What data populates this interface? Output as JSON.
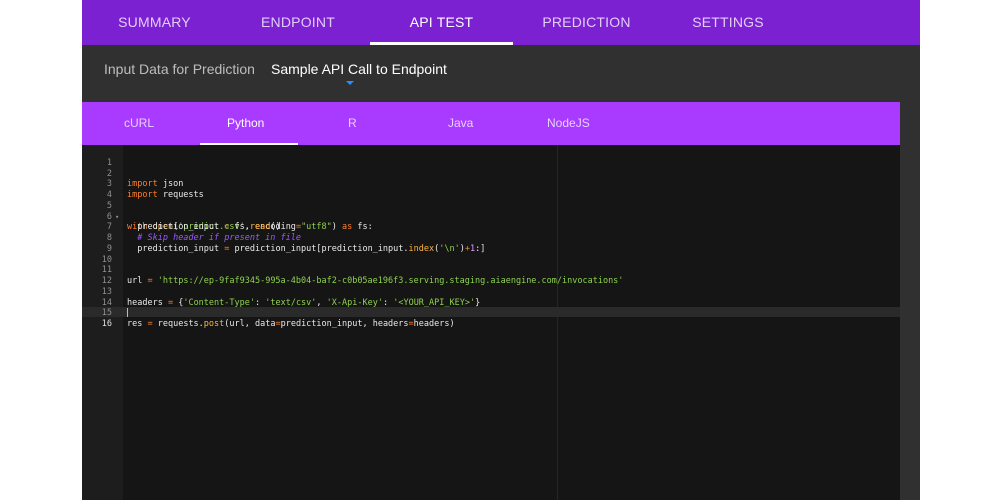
{
  "top_tabs": [
    "SUMMARY",
    "ENDPOINT",
    "API TEST",
    "PREDICTION",
    "SETTINGS"
  ],
  "sub_tabs": [
    "Input Data for Prediction",
    "Sample API Call to Endpoint"
  ],
  "language_tabs": [
    "cURL",
    "Python",
    "R",
    "Java",
    "NodeJS"
  ],
  "active_top_tab": "API TEST",
  "active_sub_tab": "Sample API Call to Endpoint",
  "active_language": "Python",
  "colors": {
    "top_bar": "#7b21d2",
    "language_bar": "#a93aff",
    "editor_bg": "#151515"
  },
  "code_line_numbers": [
    "1",
    "2",
    "3",
    "4",
    "5",
    "6",
    "7",
    "8",
    "9",
    "10",
    "11",
    "12",
    "13",
    "14",
    "15",
    "16"
  ],
  "code_tokens": {
    "import": "import",
    "json": " json",
    "requests": " requests",
    "with": "with",
    "open": "open",
    "open_paren": "(",
    "predict_csv": "'predict.csv'",
    "encoding_kw": ", encoding",
    "eq": "=",
    "utf8": "\"utf8\"",
    "close_paren": ")",
    "as": "as",
    "fs_colon": " fs:",
    "indent": "  ",
    "prediction_input": "prediction_input",
    "fs_read": "fs.",
    "read": "read",
    "parens": "()",
    "comment": "# Skip header if present in file",
    "slice_start": "prediction_input[prediction_input.",
    "index": "index",
    "newline_str": "'\\n'",
    "plus": "+",
    "one": "1",
    "slice_end": ":]",
    "url": "url",
    "url_value": "'https://ep-9faf9345-995a-4b04-baf2-c0b05ae196f3.serving.staging.aiaengine.com/invocations'",
    "headers": "headers",
    "brace_open": "{",
    "content_type_key": "'Content-Type'",
    "colon": ": ",
    "content_type_val": "'text/csv'",
    "comma": ", ",
    "api_key_key": "'X-Api-Key'",
    "api_key_val": "'<YOUR_API_KEY>'",
    "brace_close": "}",
    "res": "res",
    "requests_dot": "requests.",
    "post": "post",
    "post_args_1": "(url, data",
    "post_args_2": "prediction_input, headers",
    "post_args_3": "headers)"
  }
}
